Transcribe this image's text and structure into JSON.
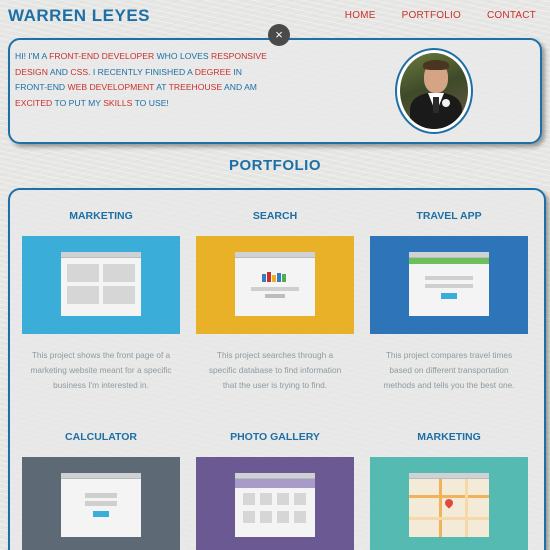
{
  "header": {
    "brand": "WARREN LEYES",
    "nav": [
      "HOME",
      "PORTFOLIO",
      "CONTACT"
    ]
  },
  "bio": {
    "close": "×",
    "parts": [
      {
        "t": "HI! I'M A ",
        "hl": false
      },
      {
        "t": "FRONT-END DEVELOPER",
        "hl": true
      },
      {
        "t": " WHO LOVES ",
        "hl": false
      },
      {
        "t": "RESPONSIVE DESIGN",
        "hl": true
      },
      {
        "t": " AND ",
        "hl": false
      },
      {
        "t": "CSS",
        "hl": true
      },
      {
        "t": ". I RECENTLY FINISHED A ",
        "hl": false
      },
      {
        "t": "DEGREE",
        "hl": true
      },
      {
        "t": " IN FRONT-END ",
        "hl": false
      },
      {
        "t": "WEB DEVELOPMENT",
        "hl": true
      },
      {
        "t": " AT ",
        "hl": false
      },
      {
        "t": "TREEHOUSE",
        "hl": true
      },
      {
        "t": " AND AM ",
        "hl": false
      },
      {
        "t": "EXCITED",
        "hl": true
      },
      {
        "t": " TO PUT MY ",
        "hl": false
      },
      {
        "t": "SKILLS",
        "hl": true
      },
      {
        "t": " TO USE!",
        "hl": false
      }
    ]
  },
  "portfolio": {
    "title": "PORTFOLIO",
    "projects": [
      {
        "title": "MARKETING",
        "desc": "This project shows the front page of a marketing website meant for a specific business I'm interested in.",
        "color": "#3aaed8",
        "icon": "marketing-mockup-icon"
      },
      {
        "title": "SEARCH",
        "desc": "This project searches through a specific database to find information that the user is trying to find.",
        "color": "#e8b128",
        "icon": "search-mockup-icon"
      },
      {
        "title": "TRAVEL APP",
        "desc": "This project compares travel times based on different transportation methods and tells you the best one.",
        "color": "#2d74b8",
        "icon": "travel-mockup-icon"
      },
      {
        "title": "CALCULATOR",
        "desc": "",
        "color": "#5d6a75",
        "icon": "calculator-mockup-icon"
      },
      {
        "title": "PHOTO GALLERY",
        "desc": "",
        "color": "#6a5992",
        "icon": "gallery-mockup-icon"
      },
      {
        "title": "MARKETING",
        "desc": "",
        "color": "#55bbb2",
        "icon": "map-mockup-icon"
      }
    ]
  }
}
